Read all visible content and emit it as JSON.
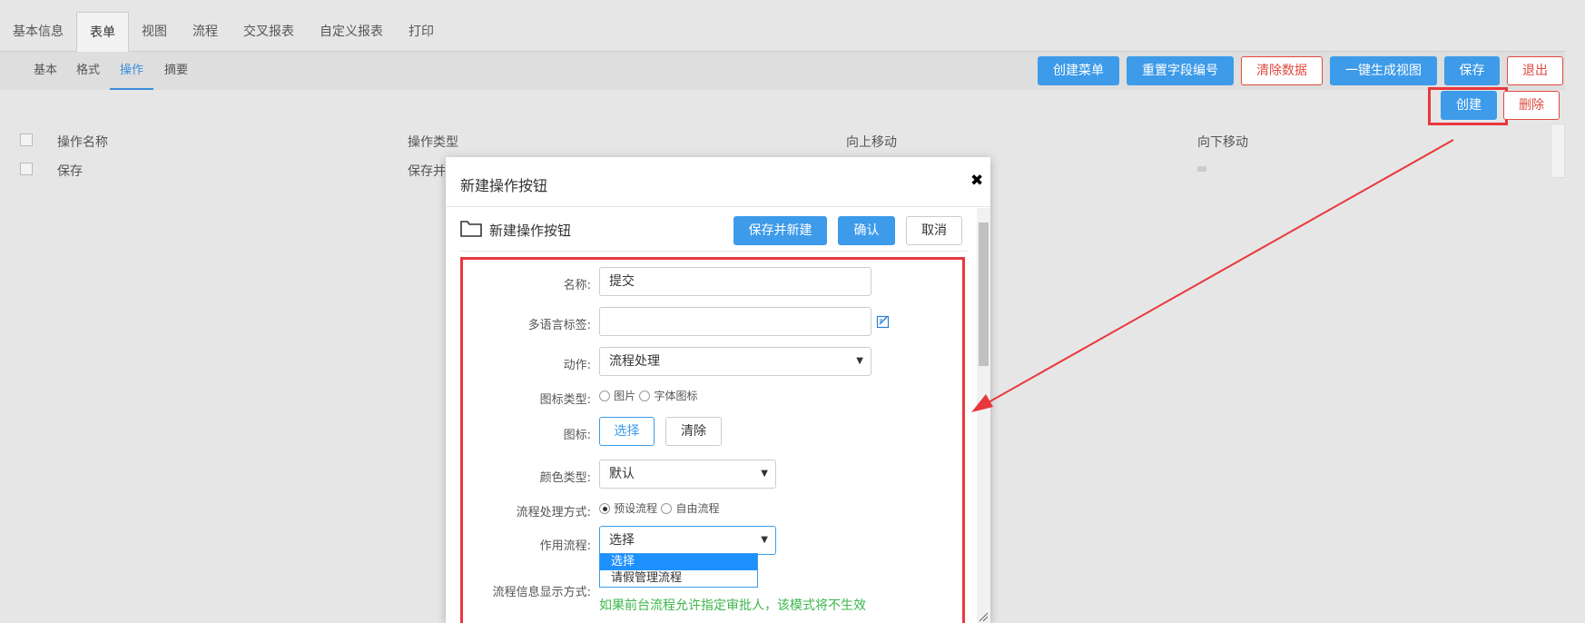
{
  "top_tabs": [
    "基本信息",
    "表单",
    "视图",
    "流程",
    "交叉报表",
    "自定义报表",
    "打印"
  ],
  "sub_tabs": [
    "基本",
    "格式",
    "操作",
    "摘要"
  ],
  "toolbar": {
    "create_menu": "创建菜单",
    "reset_field_no": "重置字段编号",
    "clear_data": "清除数据",
    "gen_view": "一键生成视图",
    "save": "保存",
    "exit": "退出",
    "create": "创建",
    "delete": "删除"
  },
  "table": {
    "headers": [
      "操作名称",
      "操作类型",
      "向上移动",
      "向下移动"
    ],
    "rows": [
      {
        "name": "保存",
        "type": "保存并"
      }
    ]
  },
  "dialog": {
    "title": "新建操作按钮",
    "header": "新建操作按钮",
    "save_new": "保存并新建",
    "confirm": "确认",
    "cancel": "取消",
    "fields": {
      "name_label": "名称:",
      "name_value": "提交",
      "i18n_label": "多语言标签:",
      "i18n_value": "",
      "action_label": "动作:",
      "action_value": "流程处理",
      "icon_type_label": "图标类型:",
      "icon_type_options": [
        "图片",
        "字体图标"
      ],
      "icon_label": "图标:",
      "icon_select": "选择",
      "icon_clear": "清除",
      "color_type_label": "颜色类型:",
      "color_type_value": "默认",
      "flow_mode_label": "流程处理方式:",
      "flow_mode_options": [
        "预设流程",
        "自由流程"
      ],
      "apply_flow_label": "作用流程:",
      "apply_flow_value": "选择",
      "apply_flow_options": [
        "选择",
        "请假管理流程"
      ],
      "flow_info_label": "流程信息显示方式:",
      "note": "如果前台流程允许指定审批人，该模式将不生效"
    }
  }
}
